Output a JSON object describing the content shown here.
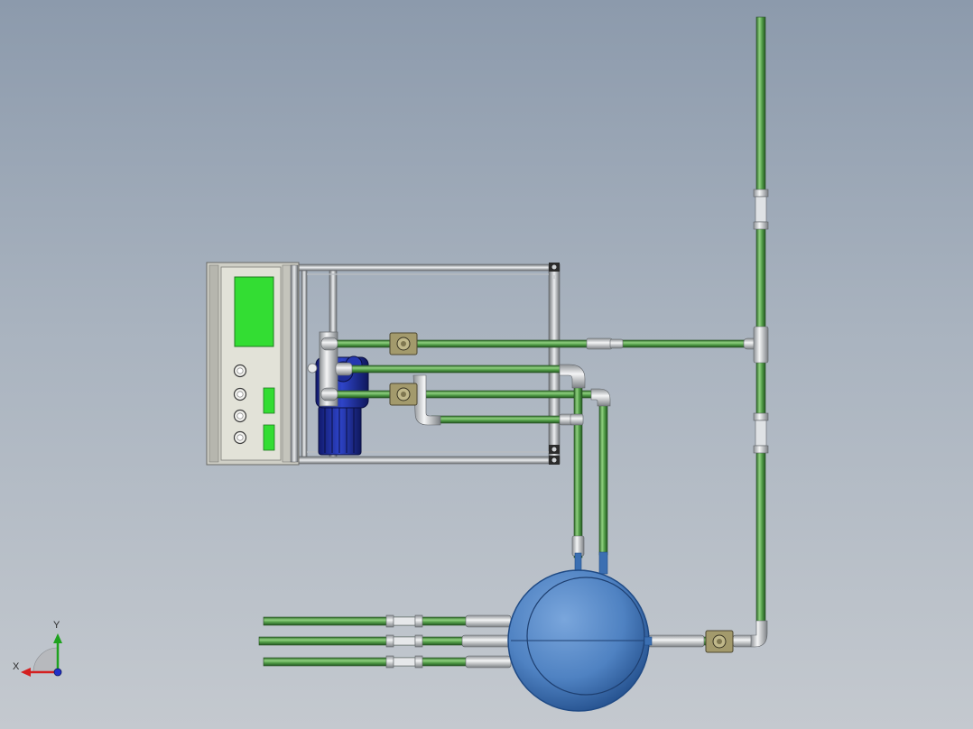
{
  "triad": {
    "x_label": "X",
    "y_label": "Y"
  },
  "colors": {
    "pipe": "#4f9a45",
    "pipe_dark": "#2f6a2a",
    "pipe_light": "#8fd07f",
    "fitting": "#e4e6e9",
    "valve": "#a39a6c",
    "tank": "#4f82c2",
    "tank_dark": "#1f4a85",
    "motor": "#1e2e9f",
    "frame": "#d8dadc",
    "cabinet": "#dcdcd2",
    "screen": "#33dd33"
  }
}
